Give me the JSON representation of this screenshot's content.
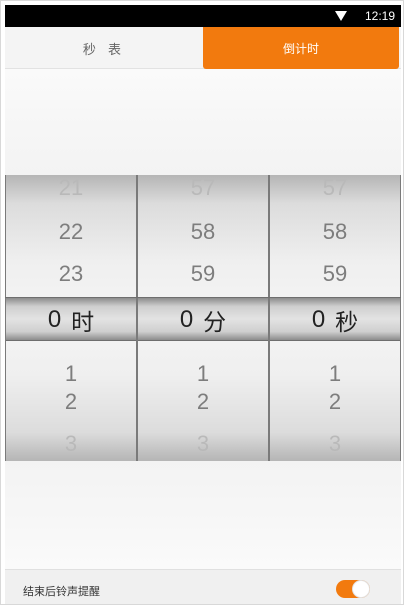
{
  "status_bar": {
    "time": "12:19",
    "wifi_icon": "wifi-icon"
  },
  "tabs": [
    {
      "label": "秒 表",
      "active": false
    },
    {
      "label": "倒计时",
      "active": true
    }
  ],
  "picker": {
    "hours": {
      "above": [
        "21",
        "22",
        "23"
      ],
      "selected": "0",
      "unit": "时",
      "below": [
        "1",
        "2",
        "3"
      ]
    },
    "minutes": {
      "above": [
        "57",
        "58",
        "59"
      ],
      "selected": "0",
      "unit": "分",
      "below": [
        "1",
        "2",
        "3"
      ]
    },
    "seconds": {
      "above": [
        "57",
        "58",
        "59"
      ],
      "selected": "0",
      "unit": "秒",
      "below": [
        "1",
        "2",
        "3"
      ]
    }
  },
  "settings": {
    "ring_label": "结束后铃声提醒",
    "ring_enabled": true
  },
  "colors": {
    "accent": "#f27a0e",
    "statusbar": "#000000"
  }
}
